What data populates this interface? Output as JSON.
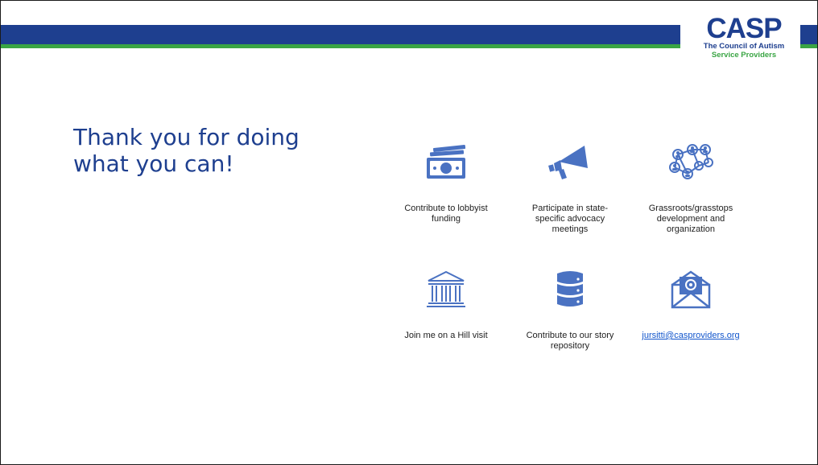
{
  "logo": {
    "word": "CASP",
    "sub_line1": "The Council of Autism",
    "sub_line2": "Service Providers"
  },
  "title": "Thank you for doing what you can!",
  "actions": [
    {
      "label": "Contribute to lobbyist funding",
      "icon": "money-icon"
    },
    {
      "label": "Participate in state-specific advocacy meetings",
      "icon": "megaphone-icon"
    },
    {
      "label": "Grassroots/grasstops development and organization",
      "icon": "network-people-icon"
    },
    {
      "label": "Join me on a Hill visit",
      "icon": "capitol-building-icon"
    },
    {
      "label": "Contribute to our story repository",
      "icon": "database-icon"
    },
    {
      "label": "jursitti@casproviders.org",
      "icon": "email-envelope-icon"
    }
  ],
  "colors": {
    "brand_blue": "#1e3f8f",
    "brand_green": "#3aa544",
    "icon_blue": "#4a72c2",
    "link": "#1155cc"
  }
}
